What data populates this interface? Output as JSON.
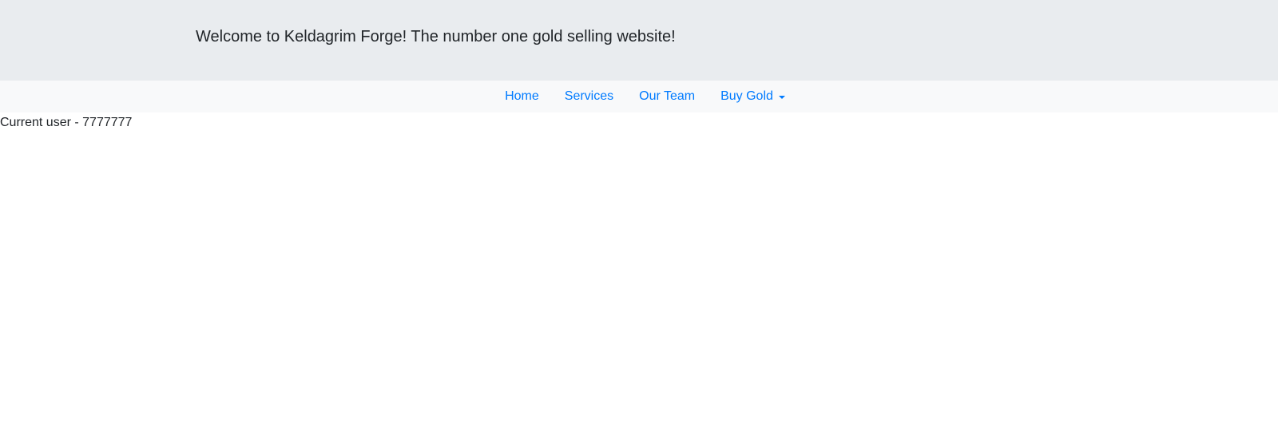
{
  "header": {
    "welcome_text": "Welcome to Keldagrim Forge! The number one gold selling website!"
  },
  "nav": {
    "items": [
      {
        "label": "Home"
      },
      {
        "label": "Services"
      },
      {
        "label": "Our Team"
      },
      {
        "label": "Buy Gold",
        "icon": "caret-down-icon"
      }
    ],
    "link_color": "#007bff"
  },
  "user": {
    "current_user_text": "Current user - 7777777"
  }
}
